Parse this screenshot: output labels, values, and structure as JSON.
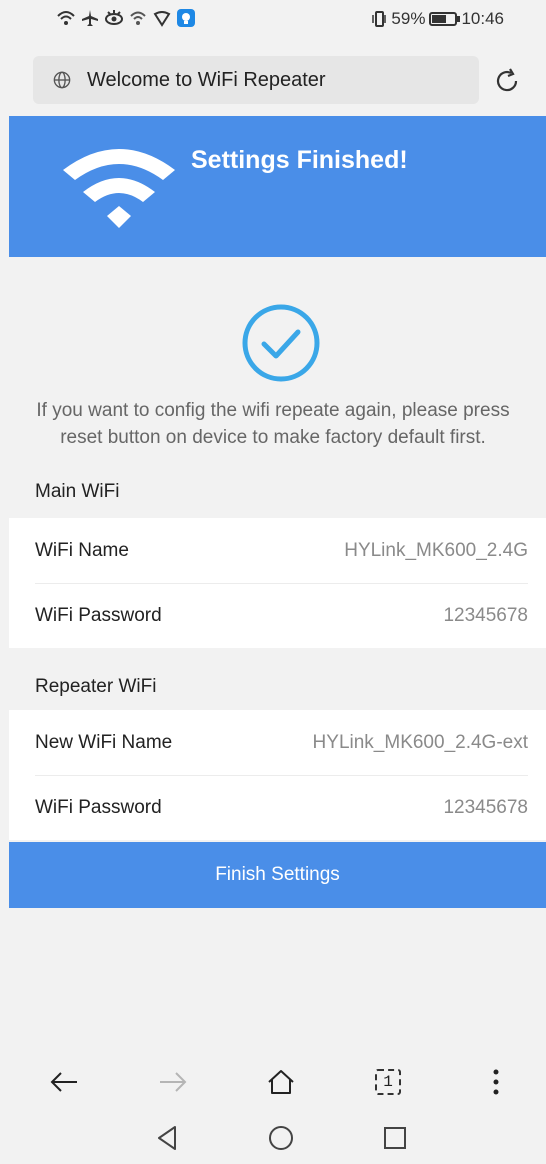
{
  "status": {
    "battery_text": "59%",
    "time": "10:46"
  },
  "address_bar": {
    "url_text": "Welcome to WiFi Repeater"
  },
  "header": {
    "title": "Settings Finished!"
  },
  "notice": {
    "line1": "If you want to config the wifi repeate again, please press",
    "line2": "reset button on device to make factory default first."
  },
  "main_wifi": {
    "section_label": "Main WiFi",
    "rows": [
      {
        "label": "WiFi Name",
        "value": "HYLink_MK600_2.4G"
      },
      {
        "label": "WiFi Password",
        "value": "12345678"
      }
    ]
  },
  "repeater_wifi": {
    "section_label": "Repeater WiFi",
    "rows": [
      {
        "label": "New WiFi Name",
        "value": "HYLink_MK600_2.4G-ext"
      },
      {
        "label": "WiFi Password",
        "value": "12345678"
      }
    ]
  },
  "finish_button": {
    "label": "Finish Settings"
  },
  "toolbar": {
    "tab_count": "1"
  },
  "colors": {
    "accent": "#4a8ee8",
    "check": "#3aa7e8"
  }
}
